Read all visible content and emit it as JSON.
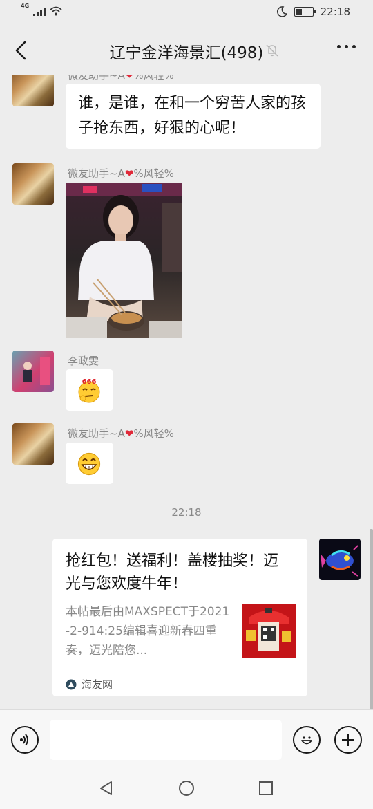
{
  "status_bar": {
    "network": "4G",
    "time": "22:18",
    "battery_level": 0.4
  },
  "header": {
    "title": "辽宁金洋海景汇(498)"
  },
  "messages": [
    {
      "sender": "微友助手~A",
      "sender_suffix": "%风轻%",
      "text": "谁，是谁，在和一个穷苦人家的孩子抢东西，好狠的心呢！"
    },
    {
      "sender": "微友助手~A",
      "sender_suffix": "%风轻%"
    },
    {
      "sender": "李政雯",
      "sticker_text": "666"
    },
    {
      "sender": "微友助手~A",
      "sender_suffix": "%风轻%"
    }
  ],
  "time_divider": "22:18",
  "shared_card": {
    "title": "抢红包！送福利！盖楼抽奖！迈光与您欢度牛年！",
    "description": "本帖最后由MAXSPECT于2021-2-914:25编辑喜迎新春四重奏，迈光陪您...",
    "source": "海友网"
  },
  "input": {
    "value": ""
  },
  "icons": [
    "signal-icon",
    "wifi-icon",
    "moon-icon",
    "battery-icon",
    "back-icon",
    "mute-icon",
    "more-icon",
    "voice-icon",
    "emoji-icon",
    "plus-icon",
    "nav-back-icon",
    "nav-home-icon",
    "nav-recents-icon"
  ]
}
